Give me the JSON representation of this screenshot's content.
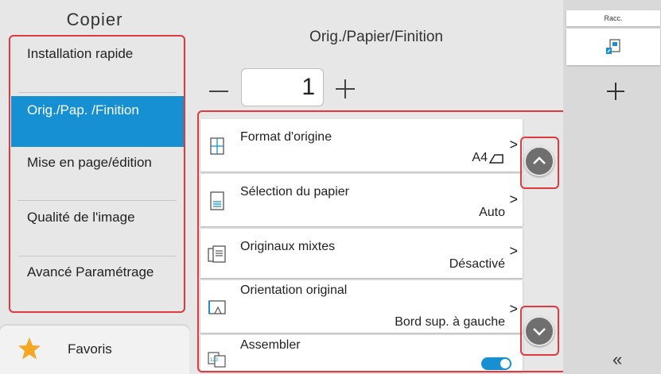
{
  "app": {
    "title": "Copier"
  },
  "nav": {
    "items": [
      {
        "label": "Installation rapide"
      },
      {
        "label": "Orig./Pap. /Finition"
      },
      {
        "label": "Mise en page/édition"
      },
      {
        "label": "Qualité de l'image"
      },
      {
        "label": "Avancé Paramétrage"
      }
    ],
    "active_index": 1
  },
  "favorites": {
    "label": "Favoris"
  },
  "main": {
    "title": "Orig./Papier/Finition",
    "copies": "1",
    "settings": [
      {
        "label": "Format d'origine",
        "value": "A4",
        "icon": "original-size-icon"
      },
      {
        "label": "Sélection du papier",
        "value": "Auto",
        "icon": "paper-tray-icon"
      },
      {
        "label": "Originaux mixtes",
        "value": "Désactivé",
        "icon": "mixed-originals-icon"
      },
      {
        "label": "Orientation original",
        "value": "Bord sup. à gauche",
        "icon": "orientation-icon"
      },
      {
        "label": "Assembler",
        "value": "on",
        "icon": "collate-icon"
      }
    ]
  },
  "shortcuts": {
    "label": "Racc."
  },
  "colors": {
    "accent": "#1690d3",
    "highlight": "#e0393e",
    "toggle": "#1690d3"
  }
}
